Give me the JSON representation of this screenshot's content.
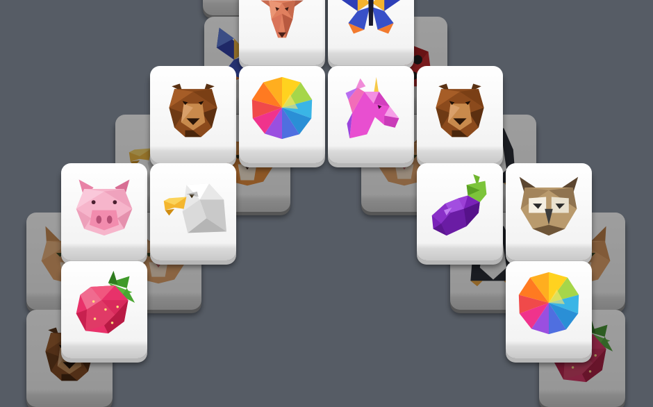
{
  "board": {
    "background": "#565c65",
    "back_tiles": [
      {
        "symbol": "cat"
      },
      {
        "symbol": "butterfly"
      },
      {
        "symbol": "ladybug"
      },
      {
        "symbol": "eagle"
      },
      {
        "symbol": "tiger"
      },
      {
        "symbol": "cat"
      },
      {
        "symbol": "penguin"
      },
      {
        "symbol": "cat"
      },
      {
        "symbol": "cat"
      },
      {
        "symbol": "cat"
      },
      {
        "symbol": "penguin"
      },
      {
        "symbol": "bear"
      },
      {
        "symbol": "strawberry"
      }
    ],
    "front_tiles": [
      {
        "symbol": "deer"
      },
      {
        "symbol": "butterfly"
      },
      {
        "symbol": "bear"
      },
      {
        "symbol": "color-ball"
      },
      {
        "symbol": "unicorn"
      },
      {
        "symbol": "bear"
      },
      {
        "symbol": "pig"
      },
      {
        "symbol": "eagle"
      },
      {
        "symbol": "eggplant"
      },
      {
        "symbol": "owl"
      },
      {
        "symbol": "strawberry"
      },
      {
        "symbol": "color-ball"
      }
    ]
  }
}
